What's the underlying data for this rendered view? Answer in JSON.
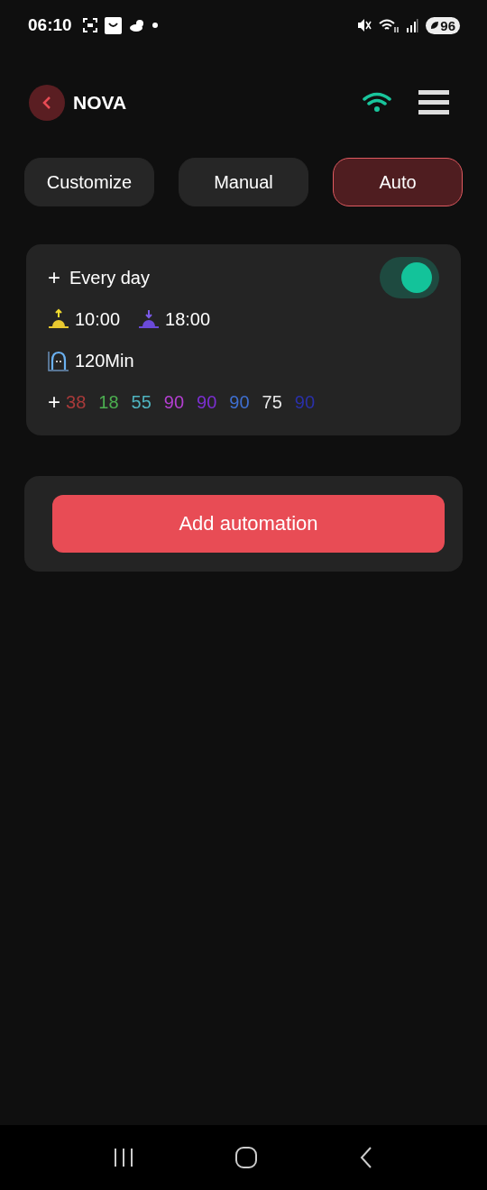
{
  "status_bar": {
    "time": "06:10",
    "battery": "96"
  },
  "header": {
    "title": "NOVA"
  },
  "tabs": [
    {
      "label": "Customize",
      "selected": false
    },
    {
      "label": "Manual",
      "selected": false
    },
    {
      "label": "Auto",
      "selected": true
    }
  ],
  "automation": {
    "plus": "+",
    "repeat": "Every day",
    "on": true,
    "start": "10:00",
    "end": "18:00",
    "duration": "120Min",
    "channels_plus": "+",
    "channels": [
      {
        "value": "38",
        "color": "#a83a3a"
      },
      {
        "value": "18",
        "color": "#4caf50"
      },
      {
        "value": "55",
        "color": "#4fb3bf"
      },
      {
        "value": "90",
        "color": "#b33fd0"
      },
      {
        "value": "90",
        "color": "#7b2fd0"
      },
      {
        "value": "90",
        "color": "#3f6fd0"
      },
      {
        "value": "75",
        "color": "#e8e8e8"
      },
      {
        "value": "90",
        "color": "#2a30a8"
      }
    ]
  },
  "add_button": "Add automation"
}
